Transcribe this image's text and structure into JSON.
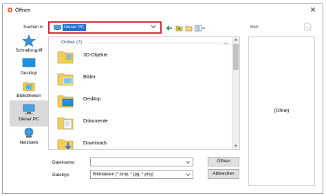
{
  "window": {
    "title": "Öffnen"
  },
  "lookin": {
    "label": "Suchen in",
    "value": "Dieser PC"
  },
  "sidebar": {
    "items": [
      {
        "label": "Schnellzugriff",
        "icon": "star-icon"
      },
      {
        "label": "Desktop",
        "icon": "desktop-icon"
      },
      {
        "label": "Bibliotheken",
        "icon": "libraries-icon"
      },
      {
        "label": "Dieser PC",
        "icon": "computer-icon",
        "active": true
      },
      {
        "label": "Netzwerk",
        "icon": "network-icon"
      }
    ]
  },
  "filelist": {
    "group": "Ordner (7)",
    "items": [
      {
        "label": "3D-Objekte",
        "icon": "folder-icon"
      },
      {
        "label": "Bilder",
        "icon": "pictures-folder-icon"
      },
      {
        "label": "Desktop",
        "icon": "desktop-folder-icon"
      },
      {
        "label": "Dokumente",
        "icon": "documents-folder-icon"
      },
      {
        "label": "Downloads",
        "icon": "downloads-folder-icon"
      }
    ]
  },
  "preview": {
    "label": "Bild:",
    "empty_text": "(Ohne)"
  },
  "filename": {
    "label": "Dateiname:",
    "value": ""
  },
  "filetype": {
    "label": "Dateityp:",
    "value": "Bilddateien (*.bmp, *.jpg, *.png)"
  },
  "buttons": {
    "open": "Öffnen",
    "cancel": "Abbrechen"
  },
  "colors": {
    "highlight": "#d0222e",
    "selection": "#1f6fd0"
  }
}
